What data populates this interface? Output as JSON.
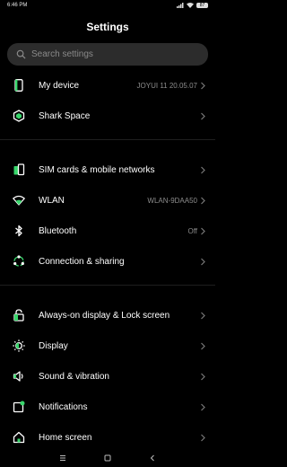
{
  "status_bar": {
    "time": "6:46 PM",
    "battery": "87"
  },
  "header": {
    "title": "Settings"
  },
  "search": {
    "placeholder": "Search settings"
  },
  "items": [
    {
      "id": "my-device",
      "icon": "phone-icon",
      "label": "My device",
      "value": "JOYUI 11 20.05.07"
    },
    {
      "id": "shark-space",
      "icon": "shark-space-icon",
      "label": "Shark Space",
      "value": ""
    },
    {
      "id": "sim-cards",
      "icon": "sim-card-icon",
      "label": "SIM cards & mobile networks",
      "value": ""
    },
    {
      "id": "wlan",
      "icon": "wifi-icon",
      "label": "WLAN",
      "value": "WLAN-9DAA50"
    },
    {
      "id": "bluetooth",
      "icon": "bluetooth-icon",
      "label": "Bluetooth",
      "value": "Off"
    },
    {
      "id": "connection-sharing",
      "icon": "connection-sharing-icon",
      "label": "Connection & sharing",
      "value": ""
    },
    {
      "id": "lock-screen",
      "icon": "lock-icon",
      "label": "Always-on display & Lock screen",
      "value": ""
    },
    {
      "id": "display",
      "icon": "sun-icon",
      "label": "Display",
      "value": ""
    },
    {
      "id": "sound",
      "icon": "speaker-icon",
      "label": "Sound & vibration",
      "value": ""
    },
    {
      "id": "notifications",
      "icon": "notification-icon",
      "label": "Notifications",
      "value": ""
    },
    {
      "id": "home-screen",
      "icon": "home-icon",
      "label": "Home screen",
      "value": ""
    }
  ],
  "colors": {
    "accent": "#38d66b",
    "background": "#000000",
    "search_bg": "#2c2c2c",
    "secondary_text": "#8c8c8c"
  },
  "navbar": {
    "icons": [
      "menu-icon",
      "home-square-icon",
      "back-icon"
    ]
  }
}
